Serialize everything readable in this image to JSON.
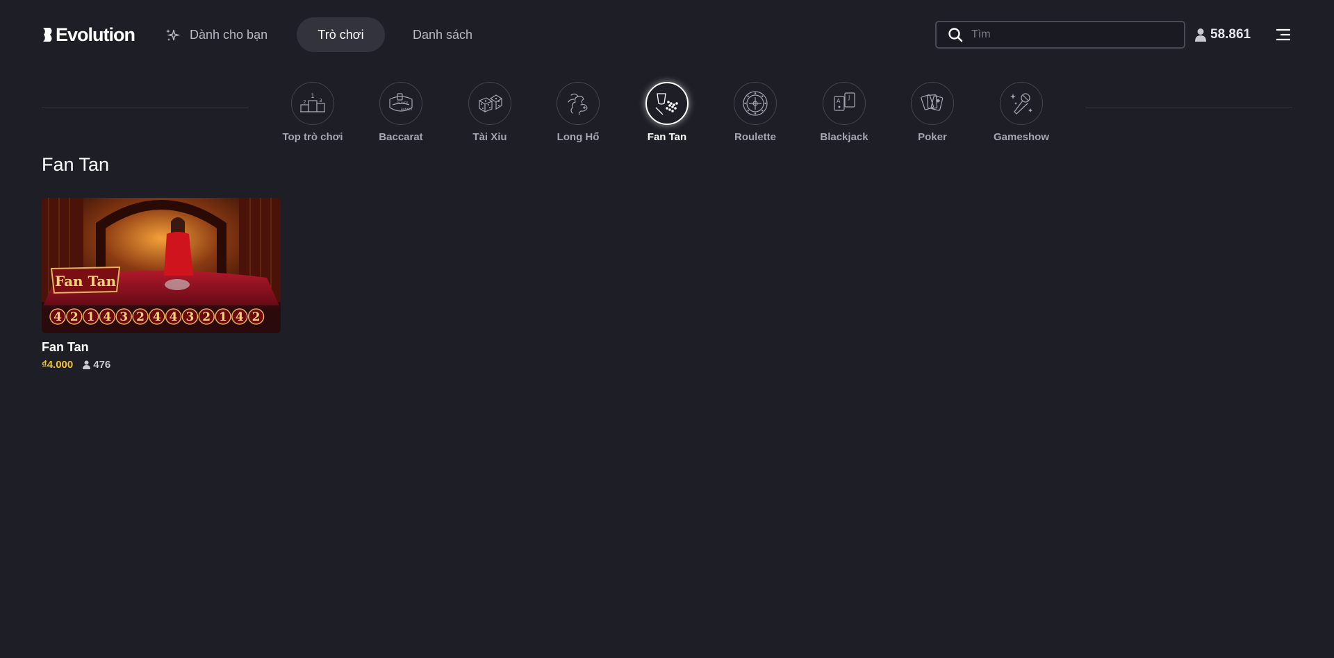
{
  "header": {
    "logo_text": "Evolution",
    "nav": {
      "for_you": "Dành cho bạn",
      "games": "Trò chơi",
      "list": "Danh sách"
    },
    "search_placeholder": "Tìm",
    "player_count": "58.861"
  },
  "categories": [
    {
      "label": "Top trò chơi",
      "icon": "podium-icon",
      "active": false
    },
    {
      "label": "Baccarat",
      "icon": "baccarat-table-icon",
      "active": false
    },
    {
      "label": "Tài Xỉu",
      "icon": "dice-icon",
      "active": false
    },
    {
      "label": "Long Hổ",
      "icon": "dragon-tiger-icon",
      "active": false
    },
    {
      "label": "Fan Tan",
      "icon": "fan-tan-icon",
      "active": true
    },
    {
      "label": "Roulette",
      "icon": "roulette-wheel-icon",
      "active": false
    },
    {
      "label": "Blackjack",
      "icon": "cards-aj-icon",
      "active": false
    },
    {
      "label": "Poker",
      "icon": "poker-cards-icon",
      "active": false
    },
    {
      "label": "Gameshow",
      "icon": "microphone-icon",
      "active": false
    }
  ],
  "section": {
    "title": "Fan Tan",
    "games": [
      {
        "name": "Fan Tan",
        "min_bet": "₫4.000",
        "players": "476",
        "thumb_logo": "Fan Tan",
        "results": [
          "4",
          "2",
          "1",
          "4",
          "3",
          "2",
          "4",
          "4",
          "3",
          "2",
          "1",
          "4",
          "2"
        ]
      }
    ]
  },
  "colors": {
    "background": "#1e1e27",
    "active_pill": "#33333d",
    "bet": "#f2c230"
  }
}
